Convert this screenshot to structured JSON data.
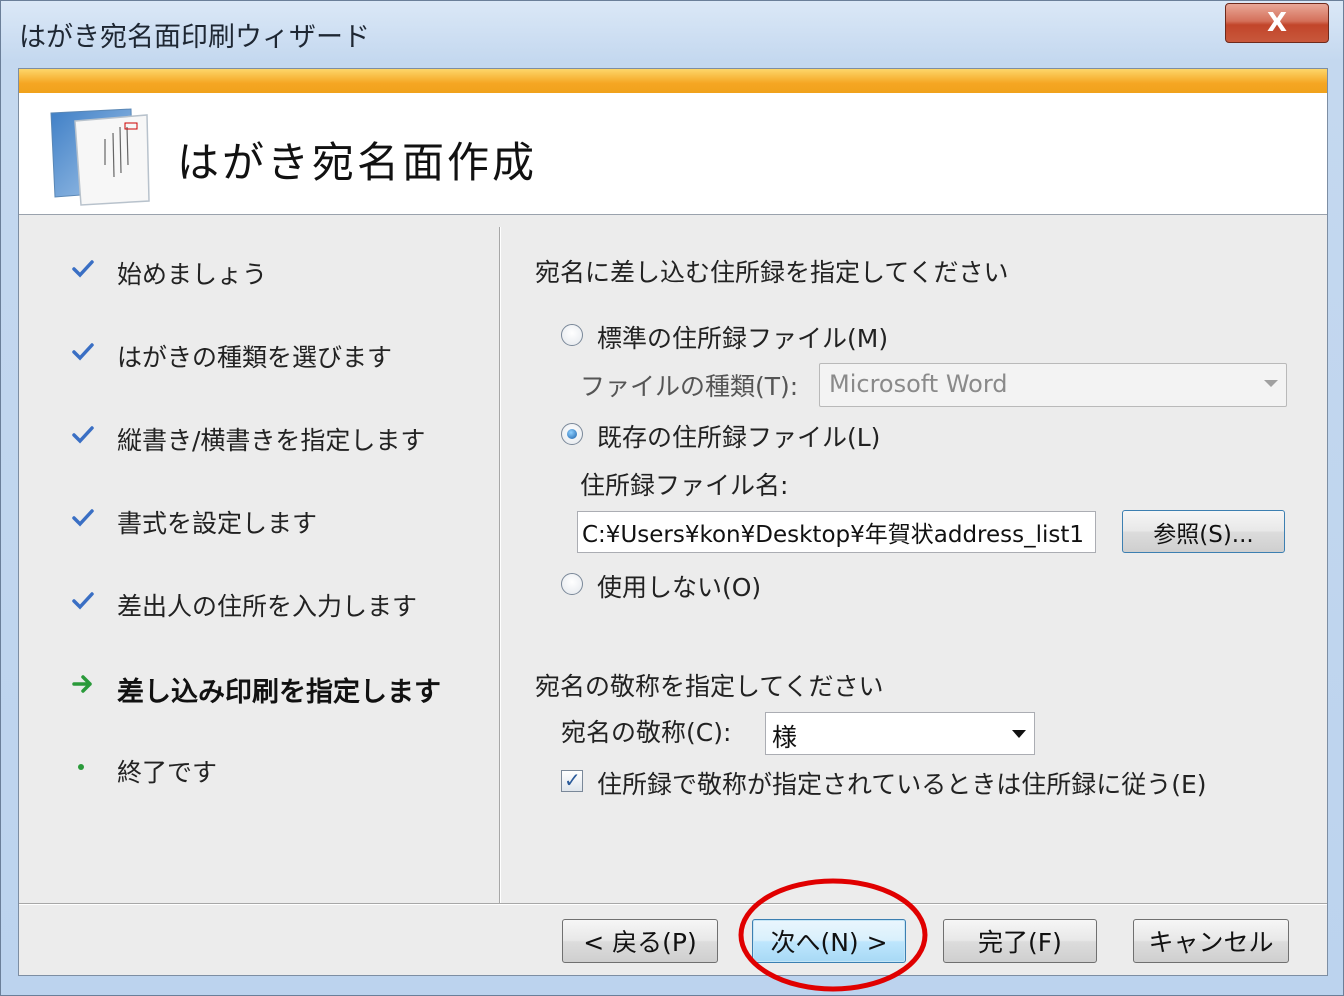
{
  "window": {
    "title": "はがき宛名面印刷ウィザード",
    "close_label": "X"
  },
  "header": {
    "title": "はがき宛名面作成"
  },
  "steps": [
    {
      "label": "始めましょう",
      "state": "done"
    },
    {
      "label": "はがきの種類を選びます",
      "state": "done"
    },
    {
      "label": "縦書き/横書きを指定します",
      "state": "done"
    },
    {
      "label": "書式を設定します",
      "state": "done"
    },
    {
      "label": "差出人の住所を入力します",
      "state": "done"
    },
    {
      "label": "差し込み印刷を指定します",
      "state": "current"
    },
    {
      "label": "終了です",
      "state": "pending"
    }
  ],
  "address_book": {
    "heading": "宛名に差し込む住所録を指定してください",
    "standard_option": "標準の住所録ファイル(M)",
    "file_type_label": "ファイルの種類(T):",
    "file_type_value": "Microsoft Word",
    "existing_option": "既存の住所録ファイル(L)",
    "file_name_label": "住所録ファイル名:",
    "file_name_value": "C:¥Users¥kon¥Desktop¥年賀状address_list1",
    "browse_button": "参照(S)...",
    "none_option": "使用しない(O)",
    "selected": "existing"
  },
  "honorific": {
    "heading": "宛名の敬称を指定してください",
    "label": "宛名の敬称(C):",
    "value": "様",
    "follow_checkbox": "住所録で敬称が指定されているときは住所録に従う(E)",
    "follow_checked": true
  },
  "buttons": {
    "back": "< 戻る(P)",
    "next": "次へ(N) >",
    "finish": "完了(F)",
    "cancel": "キャンセル"
  },
  "colors": {
    "check_mark": "#3a6fc4",
    "arrow_mark": "#2a9a3a",
    "orange_bar": "#f5a623",
    "highlight_ellipse": "#e00000"
  }
}
